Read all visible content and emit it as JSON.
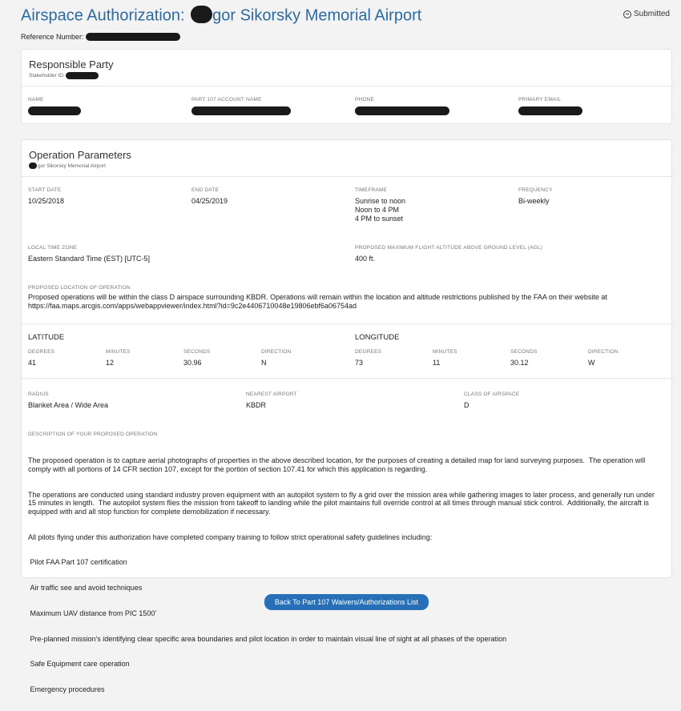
{
  "header": {
    "title_prefix": "Airspace Authorization: ",
    "title_suffix": "gor Sikorsky Memorial Airport",
    "status": "Submitted",
    "reference_label": "Reference Number:"
  },
  "responsible_party": {
    "title": "Responsible Party",
    "stakeholder_label": "Stakeholder ID:",
    "fields": [
      {
        "label": "NAME"
      },
      {
        "label": "PART 107 ACCOUNT NAME"
      },
      {
        "label": "PHONE"
      },
      {
        "label": "PRIMARY EMAIL"
      }
    ]
  },
  "operation": {
    "title": "Operation Parameters",
    "airport_sub": "gor Sikorsky Memorial Airport",
    "start_date": {
      "label": "START DATE",
      "value": "10/25/2018"
    },
    "end_date": {
      "label": "END DATE",
      "value": "04/25/2019"
    },
    "timeframe": {
      "label": "TIMEFRAME",
      "values": [
        "Sunrise to noon",
        "Noon to 4 PM",
        "4 PM to sunset"
      ]
    },
    "frequency": {
      "label": "FREQUENCY",
      "value": "Bi-weekly"
    },
    "time_zone": {
      "label": "LOCAL TIME ZONE",
      "value": "Eastern Standard Time (EST) [UTC-5]"
    },
    "altitude": {
      "label": "PROPOSED MAXIMUM FLIGHT ALTITUDE ABOVE GROUND LEVEL (AGL)",
      "value": "400 ft."
    },
    "location": {
      "label": "PROPOSED LOCATION OF OPERATION",
      "value": "Proposed operations will be within the class D airspace surrounding KBDR.  Operations will remain within the location and altitude restrictions published by the FAA on their website at https://faa.maps.arcgis.com/apps/webappviewer/index.html?id=9c2e4406710048e19806ebf6a06754ad"
    },
    "latitude": {
      "title": "LATITUDE",
      "degrees_label": "DEGREES",
      "degrees": "41",
      "minutes_label": "MINUTES",
      "minutes": "12",
      "seconds_label": "SECONDS",
      "seconds": "30.96",
      "direction_label": "DIRECTION",
      "direction": "N"
    },
    "longitude": {
      "title": "LONGITUDE",
      "degrees_label": "DEGREES",
      "degrees": "73",
      "minutes_label": "MINUTES",
      "minutes": "11",
      "seconds_label": "SECONDS",
      "seconds": "30.12",
      "direction_label": "DIRECTION",
      "direction": "W"
    },
    "radius": {
      "label": "RADIUS",
      "value": "Blanket Area / Wide Area"
    },
    "nearest_airport": {
      "label": "NEAREST AIRPORT",
      "value": "KBDR"
    },
    "airspace_class": {
      "label": "CLASS OF AIRSPACE",
      "value": "D"
    },
    "description": {
      "label": "DESCRIPTION OF YOUR PROPOSED OPERATION",
      "lines": [
        "The proposed operation is to capture aerial photographs of properties in the above described location, for the purposes of creating a detailed map for land surveying purposes.  The operation will comply with all portions of 14 CFR section 107, except for the portion of section 107.41 for which this application is regarding.",
        "The operations are conducted using standard industry proven equipment with an autopilot system to fly a grid over the mission area while gathering images to later process, and generally run under 15 minutes in length.  The autopilot system flies the mission from takeoff to landing while the pilot maintains full override control at all times through manual stick control.  Additionally, the aircraft is equipped with and all stop function for complete demobilization if necessary.",
        "All pilots flying under this authorization have completed company training to follow strict operational safety guidelines including:",
        " Pilot FAA Part 107 certification",
        " Air traffic see and avoid techniques",
        " Maximum UAV distance from PIC 1500'",
        " Pre-planned mission's identifying clear specific area boundaries and pilot location in order to maintain visual line of sight at all phases of the operation",
        " Safe Equipment care operation",
        " Emergency procedures"
      ]
    }
  },
  "footer": {
    "back_button": "Back To Part 107 Waivers/Authorizations List"
  }
}
